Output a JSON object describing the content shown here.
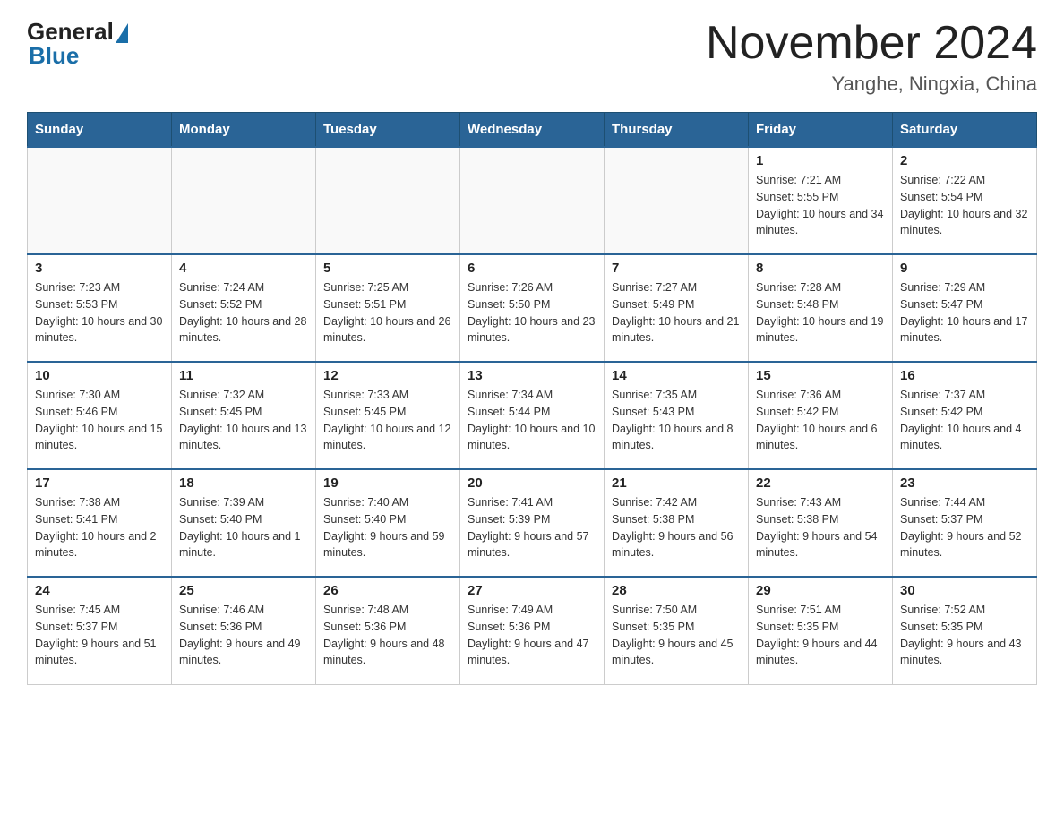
{
  "header": {
    "logo_general": "General",
    "logo_blue": "Blue",
    "title": "November 2024",
    "subtitle": "Yanghe, Ningxia, China"
  },
  "days_of_week": [
    "Sunday",
    "Monday",
    "Tuesday",
    "Wednesday",
    "Thursday",
    "Friday",
    "Saturday"
  ],
  "weeks": [
    [
      {
        "day": "",
        "info": ""
      },
      {
        "day": "",
        "info": ""
      },
      {
        "day": "",
        "info": ""
      },
      {
        "day": "",
        "info": ""
      },
      {
        "day": "",
        "info": ""
      },
      {
        "day": "1",
        "info": "Sunrise: 7:21 AM\nSunset: 5:55 PM\nDaylight: 10 hours and 34 minutes."
      },
      {
        "day": "2",
        "info": "Sunrise: 7:22 AM\nSunset: 5:54 PM\nDaylight: 10 hours and 32 minutes."
      }
    ],
    [
      {
        "day": "3",
        "info": "Sunrise: 7:23 AM\nSunset: 5:53 PM\nDaylight: 10 hours and 30 minutes."
      },
      {
        "day": "4",
        "info": "Sunrise: 7:24 AM\nSunset: 5:52 PM\nDaylight: 10 hours and 28 minutes."
      },
      {
        "day": "5",
        "info": "Sunrise: 7:25 AM\nSunset: 5:51 PM\nDaylight: 10 hours and 26 minutes."
      },
      {
        "day": "6",
        "info": "Sunrise: 7:26 AM\nSunset: 5:50 PM\nDaylight: 10 hours and 23 minutes."
      },
      {
        "day": "7",
        "info": "Sunrise: 7:27 AM\nSunset: 5:49 PM\nDaylight: 10 hours and 21 minutes."
      },
      {
        "day": "8",
        "info": "Sunrise: 7:28 AM\nSunset: 5:48 PM\nDaylight: 10 hours and 19 minutes."
      },
      {
        "day": "9",
        "info": "Sunrise: 7:29 AM\nSunset: 5:47 PM\nDaylight: 10 hours and 17 minutes."
      }
    ],
    [
      {
        "day": "10",
        "info": "Sunrise: 7:30 AM\nSunset: 5:46 PM\nDaylight: 10 hours and 15 minutes."
      },
      {
        "day": "11",
        "info": "Sunrise: 7:32 AM\nSunset: 5:45 PM\nDaylight: 10 hours and 13 minutes."
      },
      {
        "day": "12",
        "info": "Sunrise: 7:33 AM\nSunset: 5:45 PM\nDaylight: 10 hours and 12 minutes."
      },
      {
        "day": "13",
        "info": "Sunrise: 7:34 AM\nSunset: 5:44 PM\nDaylight: 10 hours and 10 minutes."
      },
      {
        "day": "14",
        "info": "Sunrise: 7:35 AM\nSunset: 5:43 PM\nDaylight: 10 hours and 8 minutes."
      },
      {
        "day": "15",
        "info": "Sunrise: 7:36 AM\nSunset: 5:42 PM\nDaylight: 10 hours and 6 minutes."
      },
      {
        "day": "16",
        "info": "Sunrise: 7:37 AM\nSunset: 5:42 PM\nDaylight: 10 hours and 4 minutes."
      }
    ],
    [
      {
        "day": "17",
        "info": "Sunrise: 7:38 AM\nSunset: 5:41 PM\nDaylight: 10 hours and 2 minutes."
      },
      {
        "day": "18",
        "info": "Sunrise: 7:39 AM\nSunset: 5:40 PM\nDaylight: 10 hours and 1 minute."
      },
      {
        "day": "19",
        "info": "Sunrise: 7:40 AM\nSunset: 5:40 PM\nDaylight: 9 hours and 59 minutes."
      },
      {
        "day": "20",
        "info": "Sunrise: 7:41 AM\nSunset: 5:39 PM\nDaylight: 9 hours and 57 minutes."
      },
      {
        "day": "21",
        "info": "Sunrise: 7:42 AM\nSunset: 5:38 PM\nDaylight: 9 hours and 56 minutes."
      },
      {
        "day": "22",
        "info": "Sunrise: 7:43 AM\nSunset: 5:38 PM\nDaylight: 9 hours and 54 minutes."
      },
      {
        "day": "23",
        "info": "Sunrise: 7:44 AM\nSunset: 5:37 PM\nDaylight: 9 hours and 52 minutes."
      }
    ],
    [
      {
        "day": "24",
        "info": "Sunrise: 7:45 AM\nSunset: 5:37 PM\nDaylight: 9 hours and 51 minutes."
      },
      {
        "day": "25",
        "info": "Sunrise: 7:46 AM\nSunset: 5:36 PM\nDaylight: 9 hours and 49 minutes."
      },
      {
        "day": "26",
        "info": "Sunrise: 7:48 AM\nSunset: 5:36 PM\nDaylight: 9 hours and 48 minutes."
      },
      {
        "day": "27",
        "info": "Sunrise: 7:49 AM\nSunset: 5:36 PM\nDaylight: 9 hours and 47 minutes."
      },
      {
        "day": "28",
        "info": "Sunrise: 7:50 AM\nSunset: 5:35 PM\nDaylight: 9 hours and 45 minutes."
      },
      {
        "day": "29",
        "info": "Sunrise: 7:51 AM\nSunset: 5:35 PM\nDaylight: 9 hours and 44 minutes."
      },
      {
        "day": "30",
        "info": "Sunrise: 7:52 AM\nSunset: 5:35 PM\nDaylight: 9 hours and 43 minutes."
      }
    ]
  ]
}
